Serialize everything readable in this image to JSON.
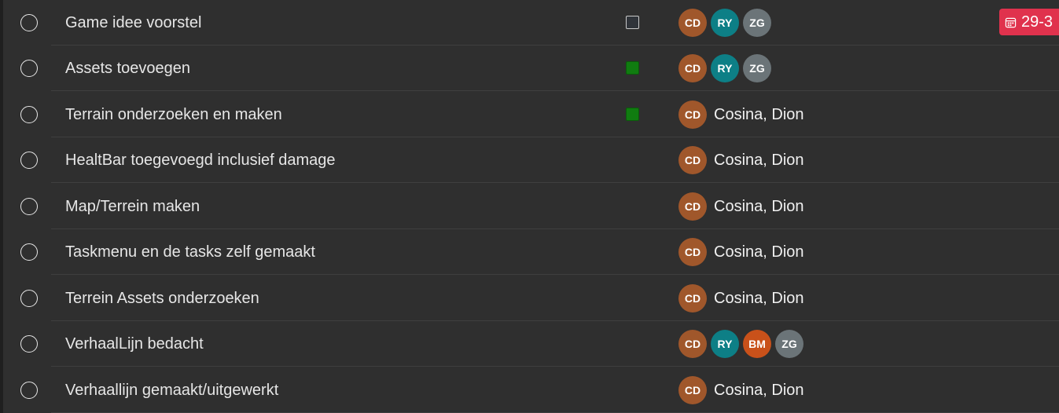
{
  "colors": {
    "avatar_CD": "#a0572b",
    "avatar_RY": "#0d7f86",
    "avatar_ZG": "#6b7478",
    "avatar_BM": "#c9511a",
    "status_green": "#107c10",
    "due_badge": "#e0324d"
  },
  "tasks": [
    {
      "title": "Game idee voorstel",
      "status": "empty",
      "assignees": [
        "CD",
        "RY",
        "ZG"
      ],
      "assignee_name": "",
      "due": "29-3"
    },
    {
      "title": "Assets toevoegen",
      "status": "green",
      "assignees": [
        "CD",
        "RY",
        "ZG"
      ],
      "assignee_name": "",
      "due": ""
    },
    {
      "title": "Terrain onderzoeken en maken",
      "status": "green",
      "assignees": [
        "CD"
      ],
      "assignee_name": "Cosina, Dion",
      "due": ""
    },
    {
      "title": "HealtBar toegevoegd inclusief damage",
      "status": "none",
      "assignees": [
        "CD"
      ],
      "assignee_name": "Cosina, Dion",
      "due": ""
    },
    {
      "title": "Map/Terrein maken",
      "status": "none",
      "assignees": [
        "CD"
      ],
      "assignee_name": "Cosina, Dion",
      "due": ""
    },
    {
      "title": "Taskmenu en de tasks zelf gemaakt",
      "status": "none",
      "assignees": [
        "CD"
      ],
      "assignee_name": "Cosina, Dion",
      "due": ""
    },
    {
      "title": "Terrein Assets onderzoeken",
      "status": "none",
      "assignees": [
        "CD"
      ],
      "assignee_name": "Cosina, Dion",
      "due": ""
    },
    {
      "title": "VerhaalLijn bedacht",
      "status": "none",
      "assignees": [
        "CD",
        "RY",
        "BM",
        "ZG"
      ],
      "assignee_name": "",
      "due": ""
    },
    {
      "title": "Verhaallijn gemaakt/uitgewerkt",
      "status": "none",
      "assignees": [
        "CD"
      ],
      "assignee_name": "Cosina, Dion",
      "due": ""
    }
  ]
}
